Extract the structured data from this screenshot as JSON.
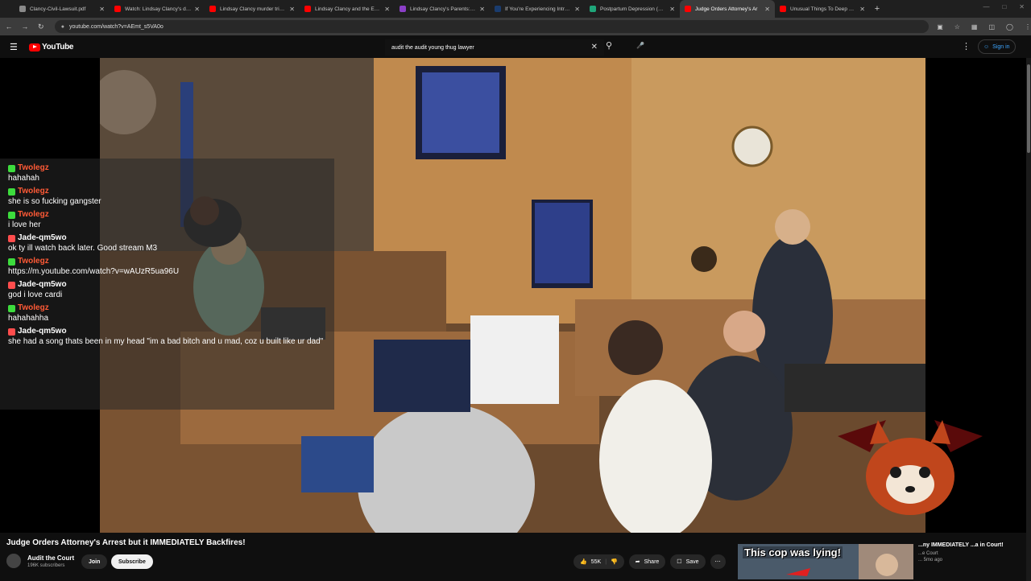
{
  "browser": {
    "tabs": [
      {
        "title": "Clancy-Civil-Lawsuit.pdf",
        "favicon_color": "#8a8a8a"
      },
      {
        "title": "Watch: Lindsay Clancy's defens",
        "favicon_color": "#ff0000"
      },
      {
        "title": "Lindsay Clancy murder trial: Pr",
        "favicon_color": "#ff0000"
      },
      {
        "title": "Lindsay Clancy and the Eviden",
        "favicon_color": "#ff0000"
      },
      {
        "title": "Lindsay Clancy's Parents: $1 Mi",
        "favicon_color": "#8b3fc7"
      },
      {
        "title": "If You're Experiencing Intrusive",
        "favicon_color": "#1a3c6e"
      },
      {
        "title": "Postpartum Depression (PPD): ",
        "favicon_color": "#1fa67a"
      },
      {
        "title": "Judge Orders Attorney's Ar",
        "favicon_color": "#ff0000",
        "active": true
      },
      {
        "title": "Unusual Things To Deep Fry - Y",
        "favicon_color": "#ff0000"
      }
    ],
    "url": "youtube.com/watch?v=AEmt_s5VA0o"
  },
  "header": {
    "logo_text": "YouTube",
    "search_value": "audit the audit young thug lawyer",
    "signin_label": "Sign in"
  },
  "chat": {
    "messages": [
      {
        "user": "Twolegz",
        "badge": "green",
        "text": "hahahah"
      },
      {
        "user": "Twolegz",
        "badge": "green",
        "text": "she is so fucking gangster"
      },
      {
        "user": "Twolegz",
        "badge": "green",
        "text": "i love her"
      },
      {
        "user": "Jade-qm5wo",
        "badge": "red",
        "text": "ok ty ill watch back later. Good stream M3"
      },
      {
        "user": "Twolegz",
        "badge": "green",
        "text": "https://m.youtube.com/watch?v=wAUzR5ua96U"
      },
      {
        "user": "Jade-qm5wo",
        "badge": "red",
        "text": "god i love cardi"
      },
      {
        "user": "Twolegz",
        "badge": "green",
        "text": "hahahahha"
      },
      {
        "user": "Jade-qm5wo",
        "badge": "red",
        "text": "she had a song thats been in my head \"im a bad bitch and u mad, coz u built like ur dad\""
      }
    ],
    "colors": {
      "green": "#3ddc3d",
      "red": "#ff4d4d",
      "twolegz_name": "#ff5a36",
      "jade_name": "#ffffff"
    }
  },
  "video": {
    "title": "Judge Orders Attorney's Arrest but it IMMEDIATELY Backfires!",
    "channel": "Audit the Court",
    "subscribers": "196K subscribers",
    "join_label": "Join",
    "subscribe_label": "Subscribe",
    "likes": "55K",
    "share_label": "Share",
    "save_label": "Save"
  },
  "related": {
    "thumbnail_caption": "This cop was lying!",
    "title": "...ny IMMEDIATELY ...a in Court!",
    "channel": "...e Court",
    "meta": "...  5mo ago"
  }
}
